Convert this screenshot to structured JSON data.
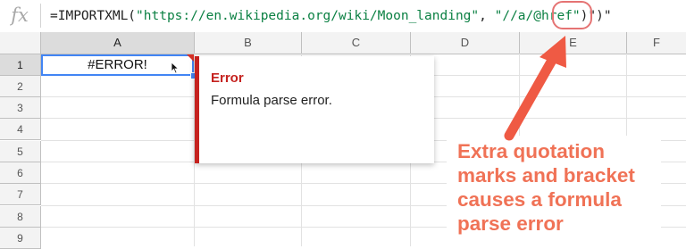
{
  "formula_bar": {
    "fx_label": "fx",
    "formula_prefix": "=IMPORTXML(",
    "url_string": "\"https://en.wikipedia.org/wiki/Moon_landing\"",
    "separator": ", ",
    "xpath_string": "\"//a/@href\"",
    "extra_chars": ")\")\""
  },
  "columns": [
    "A",
    "B",
    "C",
    "D",
    "E",
    "F"
  ],
  "rows": [
    "1",
    "2",
    "3",
    "4",
    "5",
    "6",
    "7",
    "8",
    "9"
  ],
  "cell_a1": {
    "value": "#ERROR!"
  },
  "error_popup": {
    "title": "Error",
    "message": "Formula parse error."
  },
  "annotation": {
    "lines": [
      "Extra quotation",
      "marks and bracket",
      "causes a formula",
      "parse error"
    ],
    "color": "#f07256"
  },
  "colors": {
    "selection": "#4285f4",
    "error_red": "#c5221f",
    "formula_string": "#0b8043",
    "arrow": "#ef5a44"
  }
}
